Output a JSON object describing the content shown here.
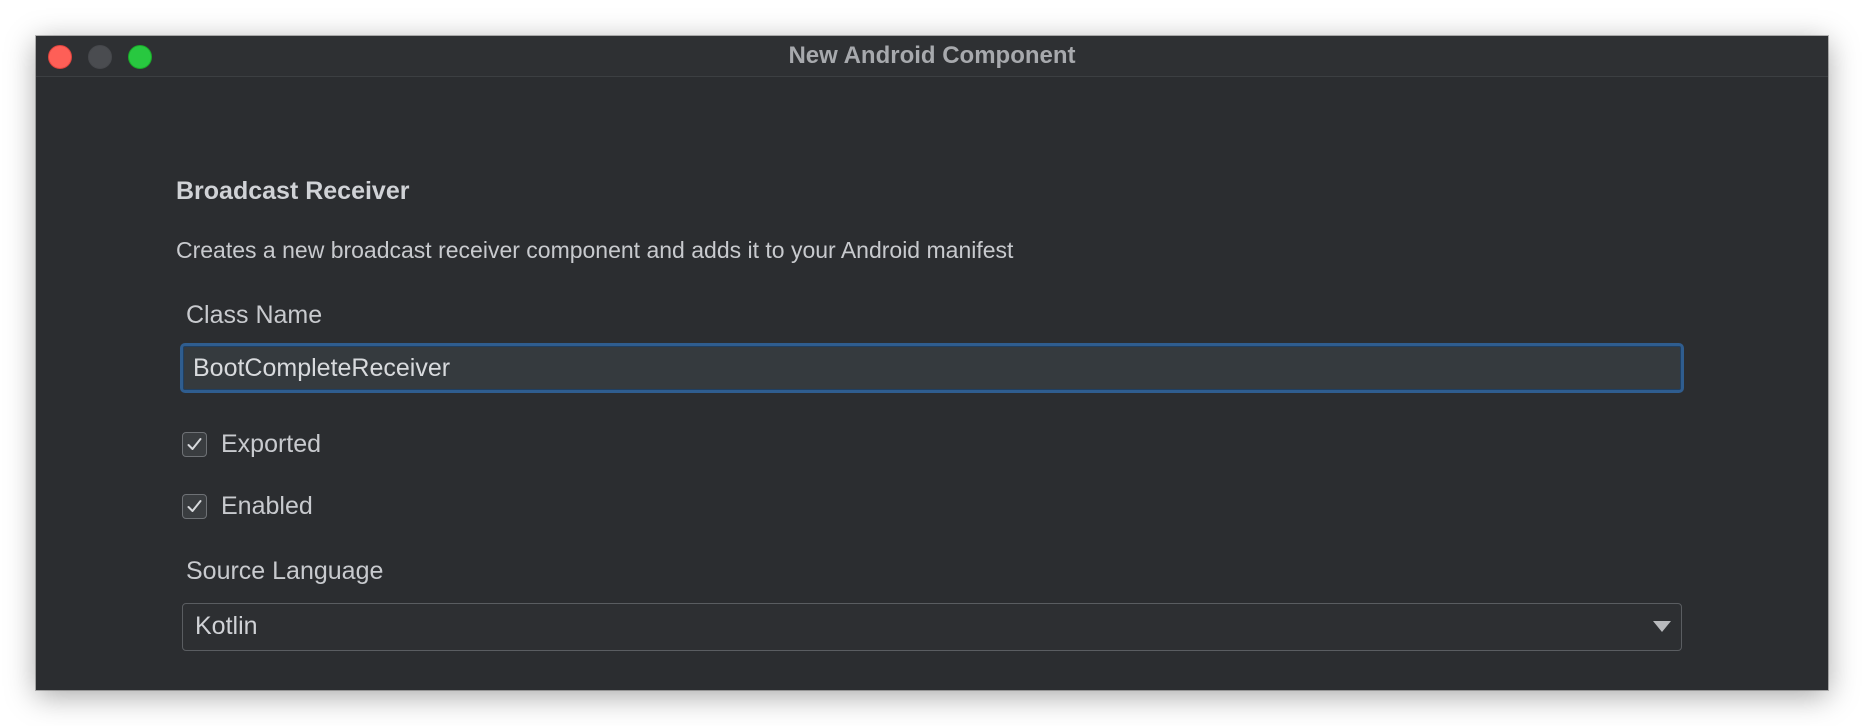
{
  "window": {
    "title": "New Android Component"
  },
  "header": {
    "title": "Broadcast Receiver",
    "description": "Creates a new broadcast receiver component and adds it to your Android manifest"
  },
  "form": {
    "class_name": {
      "label": "Class Name",
      "value": "BootCompleteReceiver"
    },
    "exported": {
      "label": "Exported",
      "checked": true
    },
    "enabled": {
      "label": "Enabled",
      "checked": true
    },
    "source_language": {
      "label": "Source Language",
      "selected": "Kotlin"
    }
  },
  "colors": {
    "window_bg": "#2b2d30",
    "focus_border": "#2f5d8f",
    "close": "#fe5f57",
    "zoom": "#28c840"
  }
}
